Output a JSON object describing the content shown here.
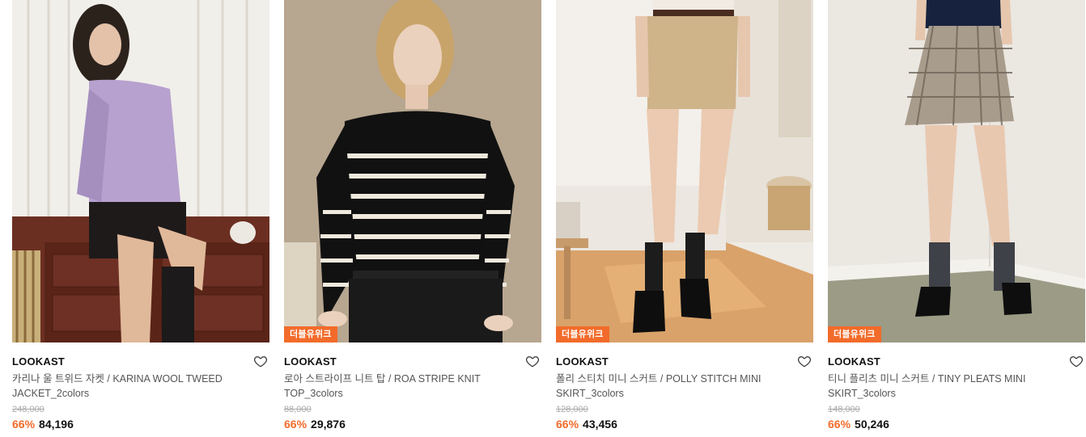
{
  "products": [
    {
      "brand": "LOOKAST",
      "name": "카리나 울 트위드 자켓 / KARINA WOOL TWEED JACKET_2colors",
      "original_price": "248,000",
      "discount": "66%",
      "price": "84,196",
      "badge": ""
    },
    {
      "brand": "LOOKAST",
      "name": "로아 스트라이프 니트 탑 / ROA STRIPE KNIT TOP_3colors",
      "original_price": "88,000",
      "discount": "66%",
      "price": "29,876",
      "badge": "더블유위크"
    },
    {
      "brand": "LOOKAST",
      "name": "폴리 스티치 미니 스커트 / POLLY STITCH MINI SKIRT_3colors",
      "original_price": "128,000",
      "discount": "66%",
      "price": "43,456",
      "badge": "더블유위크"
    },
    {
      "brand": "LOOKAST",
      "name": "티니 플리츠 미니 스커트 / TINY PLEATS MINI SKIRT_3colors",
      "original_price": "148,000",
      "discount": "66%",
      "price": "50,246",
      "badge": "더블유위크"
    }
  ],
  "colors": {
    "accent": "#f26b2a",
    "text": "#111111",
    "muted": "#555555",
    "strike": "#aaaaaa"
  },
  "icons": {
    "wishlist": "heart-outline-icon"
  }
}
